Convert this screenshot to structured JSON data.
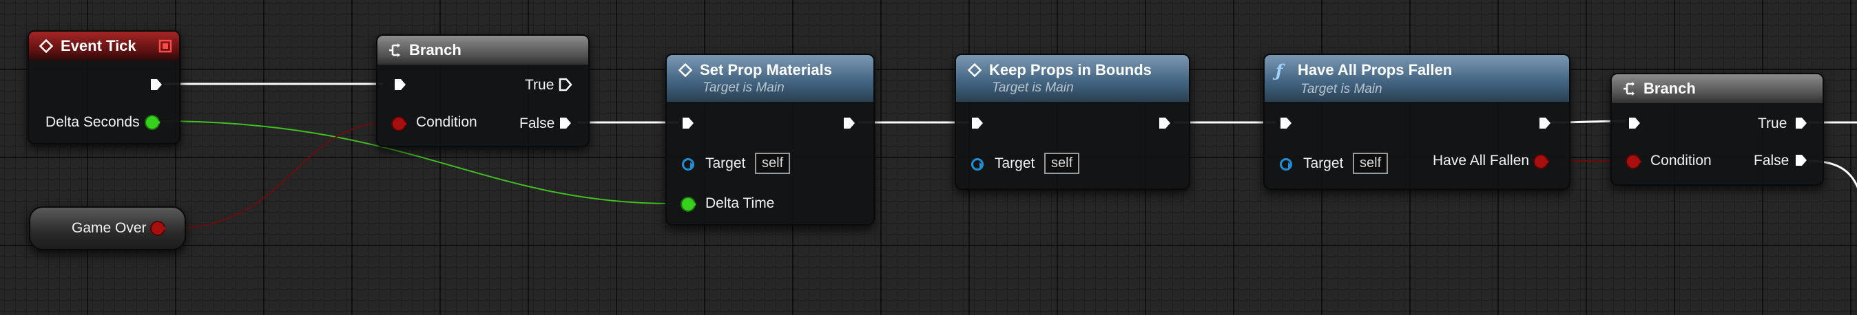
{
  "nodes": {
    "event_tick": {
      "title": "Event Tick",
      "pin_delta": "Delta Seconds"
    },
    "game_over": {
      "title": "Game Over"
    },
    "branch1": {
      "title": "Branch",
      "pin_condition": "Condition",
      "pin_true": "True",
      "pin_false": "False"
    },
    "set_prop": {
      "title": "Set Prop Materials",
      "subtitle": "Target is Main",
      "pin_target": "Target",
      "target_value": "self",
      "pin_delta_time": "Delta Time"
    },
    "keep_props": {
      "title": "Keep Props in Bounds",
      "subtitle": "Target is Main",
      "pin_target": "Target",
      "target_value": "self"
    },
    "have_all": {
      "title": "Have All Props Fallen",
      "subtitle": "Target is Main",
      "pin_target": "Target",
      "target_value": "self",
      "pin_out": "Have All Fallen"
    },
    "branch2": {
      "title": "Branch",
      "pin_condition": "Condition",
      "pin_true": "True",
      "pin_false": "False"
    }
  },
  "colors": {
    "exec_wire": "#ffffff",
    "float_wire": "#35d11c",
    "bool_wire": "#7a0a0a",
    "object_pin": "#1f8fd6"
  }
}
